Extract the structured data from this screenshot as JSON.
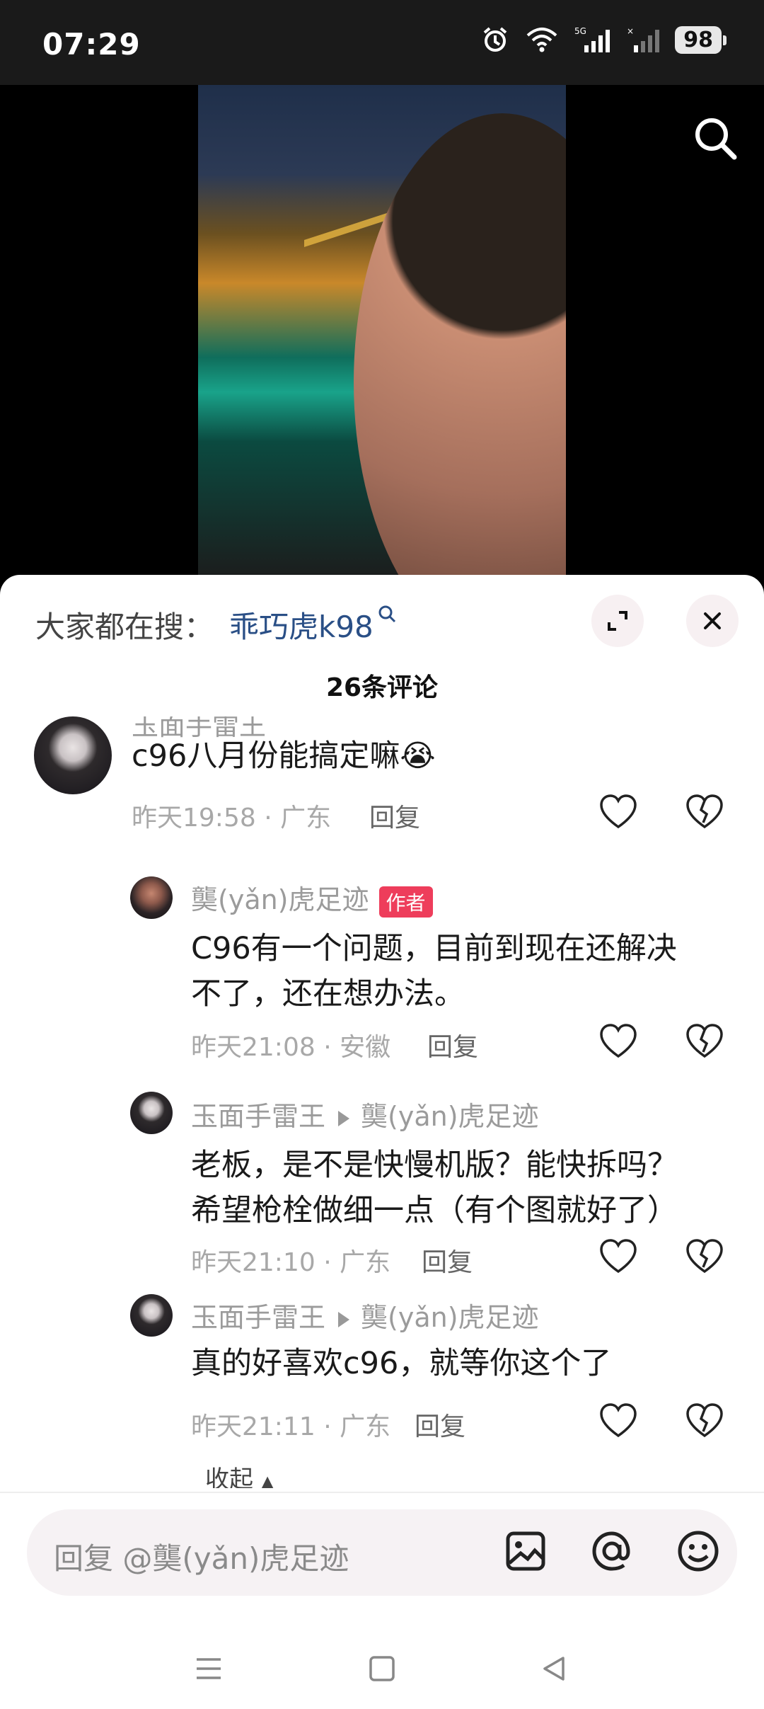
{
  "status_bar": {
    "time": "07:29",
    "battery": "98",
    "network": "5G"
  },
  "sheet": {
    "hot_search_label": "大家都在搜：",
    "hot_search_keyword": "乖巧虎k98",
    "comment_count": "26条评论"
  },
  "comments": [
    {
      "partial_name": "玉面手雷王",
      "text": "c96八月份能搞定嘛😭",
      "meta": "昨天19:58 · 广东",
      "reply": "回复"
    },
    {
      "name": "龑(yǎn)虎足迹",
      "tag": "作者",
      "text_line1": "C96有一个问题，目前到现在还解决",
      "text_line2": "不了，还在想办法。",
      "meta": "昨天21:08 · 安徽",
      "reply": "回复"
    },
    {
      "name": "玉面手雷王",
      "reply_to": "龑(yǎn)虎足迹",
      "text_line1": "老板，是不是快慢机版？能快拆吗？",
      "text_line2": "希望枪栓做细一点（有个图就好了）",
      "meta": "昨天21:10 · 广东",
      "reply": "回复"
    },
    {
      "name": "玉面手雷王",
      "reply_to": "龑(yǎn)虎足迹",
      "text": "真的好喜欢c96，就等你这个了",
      "meta": "昨天21:11 · 广东",
      "reply": "回复"
    }
  ],
  "collapse_label": "收起",
  "input": {
    "placeholder": "回复 @龑(yǎn)虎足迹"
  },
  "icons": {
    "search": "search-icon",
    "expand": "expand-icon",
    "close": "close-icon",
    "like": "heart-icon",
    "dislike": "broken-heart-icon",
    "image": "image-icon",
    "mention": "at-icon",
    "emoji": "emoji-icon",
    "menu": "menu-icon",
    "home": "home-icon",
    "back": "back-icon"
  },
  "colors": {
    "keyword": "#2a4f86",
    "author_tag": "#ee3d5b",
    "sheet_bg": "#ffffff"
  }
}
